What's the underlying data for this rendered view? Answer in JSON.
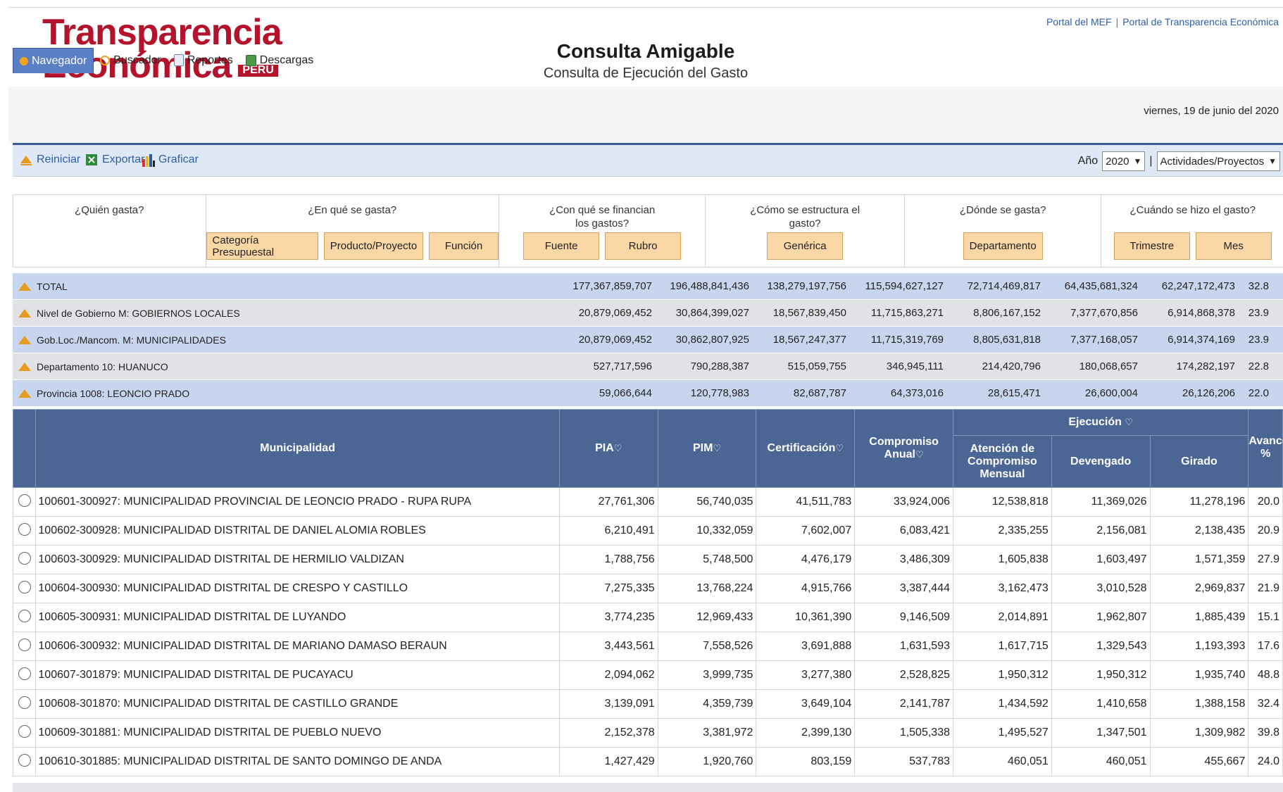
{
  "header": {
    "logo_line1": "Transparencia",
    "logo_line2": "Económica",
    "logo_badge": "PERU",
    "title": "Consulta Amigable",
    "subtitle": "Consulta de Ejecución del Gasto",
    "links": [
      "Portal del MEF",
      "Portal de Transparencia Económica"
    ],
    "date": "viernes, 19 de junio del 2020"
  },
  "tabs": [
    {
      "label": "Navegador",
      "icon": "navigator-icon",
      "active": true
    },
    {
      "label": "Buscador",
      "icon": "search-icon"
    },
    {
      "label": "Reportes",
      "icon": "report-icon"
    },
    {
      "label": "Descargas",
      "icon": "download-icon"
    }
  ],
  "toolbar": {
    "reset": "Reiniciar",
    "export": "Exportar",
    "chart": "Graficar",
    "year_label": "Año",
    "year_value": "2020",
    "separator": "|",
    "level_value": "Actividades/Proyectos"
  },
  "questions": {
    "who": "¿Quién gasta?",
    "what": "¿En qué se gasta?",
    "what_btns": [
      "Categoría Presupuestal",
      "Producto/Proyecto",
      "Función"
    ],
    "how_funded": "¿Con qué se financian los gastos?",
    "how_funded_btns": [
      "Fuente",
      "Rubro"
    ],
    "structure": "¿Cómo se estructura el gasto?",
    "structure_btns": [
      "Genérica"
    ],
    "where": "¿Dónde se gasta?",
    "where_btns": [
      "Departamento"
    ],
    "when": "¿Cuándo se hizo el gasto?",
    "when_btns": [
      "Trimestre",
      "Mes"
    ]
  },
  "summary": [
    {
      "label": "TOTAL",
      "values": [
        "177,367,859,707",
        "196,488,841,436",
        "138,279,197,756",
        "115,594,627,127",
        "72,714,469,817",
        "64,435,681,324",
        "62,247,172,473",
        "32.8"
      ]
    },
    {
      "label": "Nivel de Gobierno M: GOBIERNOS LOCALES",
      "values": [
        "20,879,069,452",
        "30,864,399,027",
        "18,567,839,450",
        "11,715,863,271",
        "8,806,167,152",
        "7,377,670,856",
        "6,914,868,378",
        "23.9"
      ]
    },
    {
      "label": "Gob.Loc./Mancom. M: MUNICIPALIDADES",
      "values": [
        "20,879,069,452",
        "30,862,807,925",
        "18,567,247,377",
        "11,715,319,769",
        "8,805,631,818",
        "7,377,168,057",
        "6,914,374,169",
        "23.9"
      ]
    },
    {
      "label": "Departamento 10: HUANUCO",
      "values": [
        "527,717,596",
        "790,288,387",
        "515,059,755",
        "346,945,111",
        "214,420,796",
        "180,068,657",
        "174,282,197",
        "22.8"
      ]
    },
    {
      "label": "Provincia 1008: LEONCIO PRADO",
      "values": [
        "59,066,644",
        "120,778,983",
        "82,687,787",
        "64,373,016",
        "28,615,471",
        "26,600,004",
        "26,126,206",
        "22.0"
      ]
    }
  ],
  "table": {
    "headers": {
      "name": "Municipalidad",
      "pia": "PIA",
      "pim": "PIM",
      "cert": "Certificación",
      "comp": "Compromiso Anual",
      "ejec": "Ejecución",
      "atencion": "Atención de Compromiso Mensual",
      "devengado": "Devengado",
      "girado": "Girado",
      "avance": "Avance %"
    },
    "rows": [
      [
        "100601-300927: MUNICIPALIDAD PROVINCIAL DE LEONCIO PRADO - RUPA RUPA",
        "27,761,306",
        "56,740,035",
        "41,511,783",
        "33,924,006",
        "12,538,818",
        "11,369,026",
        "11,278,196",
        "20.0"
      ],
      [
        "100602-300928: MUNICIPALIDAD DISTRITAL DE DANIEL ALOMIA ROBLES",
        "6,210,491",
        "10,332,059",
        "7,602,007",
        "6,083,421",
        "2,335,255",
        "2,156,081",
        "2,138,435",
        "20.9"
      ],
      [
        "100603-300929: MUNICIPALIDAD DISTRITAL DE HERMILIO VALDIZAN",
        "1,788,756",
        "5,748,500",
        "4,476,179",
        "3,486,309",
        "1,605,838",
        "1,603,497",
        "1,571,359",
        "27.9"
      ],
      [
        "100604-300930: MUNICIPALIDAD DISTRITAL DE CRESPO Y CASTILLO",
        "7,275,335",
        "13,768,224",
        "4,915,766",
        "3,387,444",
        "3,162,473",
        "3,010,528",
        "2,969,837",
        "21.9"
      ],
      [
        "100605-300931: MUNICIPALIDAD DISTRITAL DE LUYANDO",
        "3,774,235",
        "12,969,433",
        "10,361,390",
        "9,146,509",
        "2,014,891",
        "1,962,807",
        "1,885,439",
        "15.1"
      ],
      [
        "100606-300932: MUNICIPALIDAD DISTRITAL DE MARIANO DAMASO BERAUN",
        "3,443,561",
        "7,558,526",
        "3,691,888",
        "1,631,593",
        "1,617,715",
        "1,329,543",
        "1,193,393",
        "17.6"
      ],
      [
        "100607-301879: MUNICIPALIDAD DISTRITAL DE PUCAYACU",
        "2,094,062",
        "3,999,735",
        "3,277,380",
        "2,528,825",
        "1,950,312",
        "1,950,312",
        "1,935,740",
        "48.8"
      ],
      [
        "100608-301870: MUNICIPALIDAD DISTRITAL DE CASTILLO GRANDE",
        "3,139,091",
        "4,359,739",
        "3,649,104",
        "2,141,787",
        "1,434,592",
        "1,410,658",
        "1,388,158",
        "32.4"
      ],
      [
        "100609-301881: MUNICIPALIDAD DISTRITAL DE PUEBLO NUEVO",
        "2,152,378",
        "3,381,972",
        "2,399,130",
        "1,505,338",
        "1,495,527",
        "1,347,501",
        "1,309,982",
        "39.8"
      ],
      [
        "100610-301885: MUNICIPALIDAD DISTRITAL DE SANTO DOMINGO DE ANDA",
        "1,427,429",
        "1,920,760",
        "803,159",
        "537,783",
        "460,051",
        "460,051",
        "455,667",
        "24.0"
      ]
    ]
  },
  "colors": {
    "accent": "#b3132b",
    "header_blue": "#4b6695",
    "summary_blue": "#c8d5ee",
    "button_orange": "#fbd7a6"
  }
}
